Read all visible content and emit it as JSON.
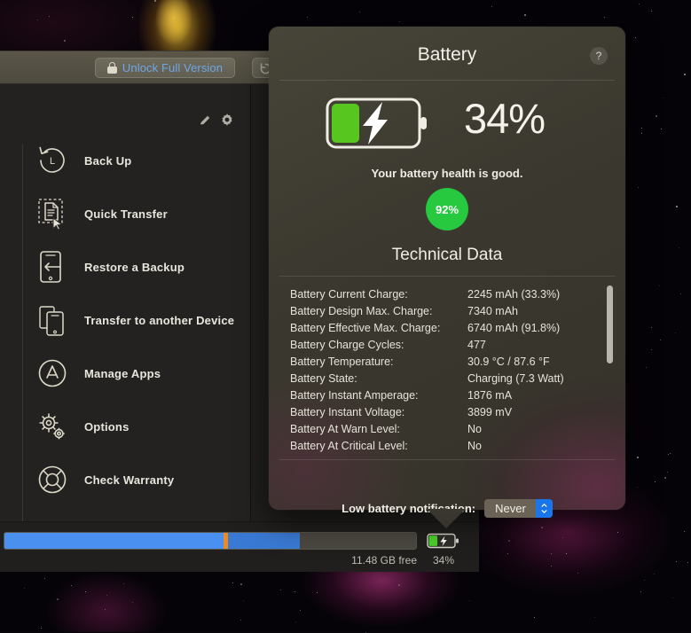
{
  "window": {
    "unlock_button": "Unlock Full Version",
    "lock_icon": "lock-icon",
    "revert_icon": "revert-icon",
    "edit_icon": "pencil-icon",
    "settings_icon": "gear-icon"
  },
  "sidebar": {
    "items": [
      {
        "label": "Back Up",
        "icon": "backup-clock-icon"
      },
      {
        "label": "Quick Transfer",
        "icon": "quick-transfer-icon"
      },
      {
        "label": "Restore a Backup",
        "icon": "restore-device-icon"
      },
      {
        "label": "Transfer to another Device",
        "icon": "transfer-devices-icon"
      },
      {
        "label": "Manage Apps",
        "icon": "app-store-icon"
      },
      {
        "label": "Options",
        "icon": "gears-icon"
      },
      {
        "label": "Check Warranty",
        "icon": "lifebuoy-icon"
      }
    ]
  },
  "statusbar": {
    "free_space": "11.48 GB free",
    "battery_percent": "34%",
    "battery_icon": "battery-charging-icon",
    "storage_segments": [
      {
        "name": "apps",
        "percent": 53.2,
        "color": "#4a90ef"
      },
      {
        "name": "divider",
        "percent": 1.1,
        "color": "#f08a1e"
      },
      {
        "name": "media",
        "percent": 17.4,
        "color": "#3a7ad4"
      },
      {
        "name": "free",
        "percent": 28.3,
        "color": "#4a4840"
      }
    ]
  },
  "popover": {
    "title": "Battery",
    "help_icon": "question-mark-icon",
    "battery_icon": "battery-charging-icon",
    "battery_fill_percent": 34,
    "charge_percent": "34%",
    "health_message": "Your battery health is good.",
    "health_percent": "92%",
    "health_color": "#27c93f",
    "technical_title": "Technical Data",
    "technical_rows": [
      {
        "label": "Battery Current Charge:",
        "value": "2245 mAh (33.3%)"
      },
      {
        "label": "Battery Design Max. Charge:",
        "value": "7340 mAh"
      },
      {
        "label": "Battery Effective Max. Charge:",
        "value": "6740 mAh (91.8%)"
      },
      {
        "label": "Battery Charge Cycles:",
        "value": "477"
      },
      {
        "label": "Battery Temperature:",
        "value": "30.9 °C / 87.6 °F"
      },
      {
        "label": "Battery State:",
        "value": "Charging (7.3 Watt)"
      },
      {
        "label": "Battery Instant Amperage:",
        "value": "1876 mA"
      },
      {
        "label": "Battery Instant Voltage:",
        "value": "3899 mV"
      },
      {
        "label": "Battery At Warn Level:",
        "value": "No"
      },
      {
        "label": "Battery At Critical Level:",
        "value": "No"
      }
    ],
    "low_battery_label": "Low battery notification:",
    "low_battery_value": "Never",
    "low_battery_options": [
      "Never"
    ]
  }
}
